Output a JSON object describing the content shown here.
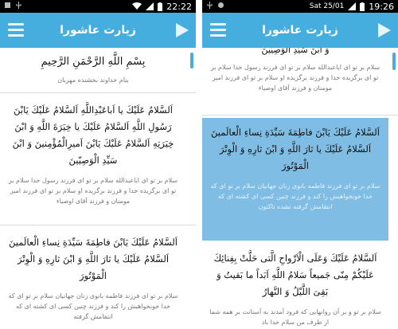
{
  "left": {
    "status": {
      "time": "22:22"
    },
    "appbar": {
      "title": "زیارت عاشورا"
    },
    "blocks": [
      {
        "arabic": "بِسْمِ اللَّهِ الرَّحْمَنِ الرَّحِيمِ",
        "trans": "بنام خداوند بخشنده مهربان"
      },
      {
        "arabic": "اَلسَّلامُ عَلَيْكَ يا اَباعَبْدِاللَّهِ اَلسَّلامُ عَلَيْكَ يَابْنَ رَسُولِ اللَّهِ اَلسَّلامُ عَلَيْكَ يا خِيَرَةَ اللَّهِ وَ ابْنَ خِيَرَتِهِ اَلسَّلامُ عَلَيْكَ يَابْنَ اَميرِالْمُؤْمِنينَ وَ ابْنَ سَيِّدِ الْوَصِيّينَ",
        "trans": "سلام بر تو ای اباعبدالله سلام بر تو ای فرزند رسول خدا سلام بر تو ای برگزیده خدا و فرزند برگزیده او سلام بر تو ای فرزند امیر مومنان و فرزند آقای اوصیاء"
      },
      {
        "arabic": "اَلسَّلامُ عَلَيْكَ يَابْنَ فاطِمَةَ سَيِّدَةِ نِساءِ الْعالَمينَ اَلسَّلامُ عَلَيْكَ يا ثارَ اللَّهِ وَ ابْنَ ثارِهِ وَ الْوِتْرَ الْمَوْتُورَ",
        "trans": "سلام بر تو ای فرزند فاطمه بانوی زنان جهانیان سلام بر تو ای که خدا خونخواهیش را کند و فرزند چنین کسی ای کشته ای که انتقامش گرفته"
      }
    ]
  },
  "right": {
    "status": {
      "date": "Sat 25/01",
      "time": "19:26"
    },
    "appbar": {
      "title": "زیارت عاشورا"
    },
    "blocks": [
      {
        "arabic": "وَ ابْنَ سَيِّدِ الْوَصِيّينَ",
        "trans": "سلام بر تو ای اباعبدالله سلام بر تو ای فرزند رسول خدا سلام بر تو ای برگزیده خدا و فرزند برگزیده او سلام بر تو ای فرزند امیر مومنان و فرزند آقای اوصیاء"
      },
      {
        "arabic": "اَلسَّلامُ عَلَيْكَ يَابْنَ فاطِمَةَ سَيِّدَةِ نِساءِ الْعالَمينَ اَلسَّلامُ عَلَيْكَ يا ثارَ اللَّهِ وَ ابْنَ ثارِهِ وَ الْوِتْرَ الْمَوْتُورَ",
        "trans": "سلام بر تو ای فرزند فاطمه بانوی زنان جهانیان سلام بر تو ای که خدا خونخواهیش را کند و فرزند چنین کسی ای کشته ای که انتقامش گرفته نشده تاکنون"
      },
      {
        "arabic": "اَلسَّلامُ عَلَيْكَ وَعَلَى الْاَرْواحِ الَّتى حَلَّتْ بِفِنائِكَ عَلَيْكُمْ مِنّى جَميعاً سَلامُ اللَّهِ اَبَداً ما بَقيتُ وَ بَقِىَ اللَّيْلُ وَ النَّهارُ",
        "trans": "سلام بر تو و بر آن روانهایی که فرود آمدند به آستانت بر همه شما از طرف من سلام خدا باد"
      }
    ]
  },
  "colors": {
    "appbar": "#45aede",
    "highlight": "#7fbde4"
  },
  "icons": [
    "menu-icon",
    "play-icon",
    "wifi-icon",
    "signal-icon",
    "battery-icon",
    "usb-icon",
    "notification-icon"
  ]
}
